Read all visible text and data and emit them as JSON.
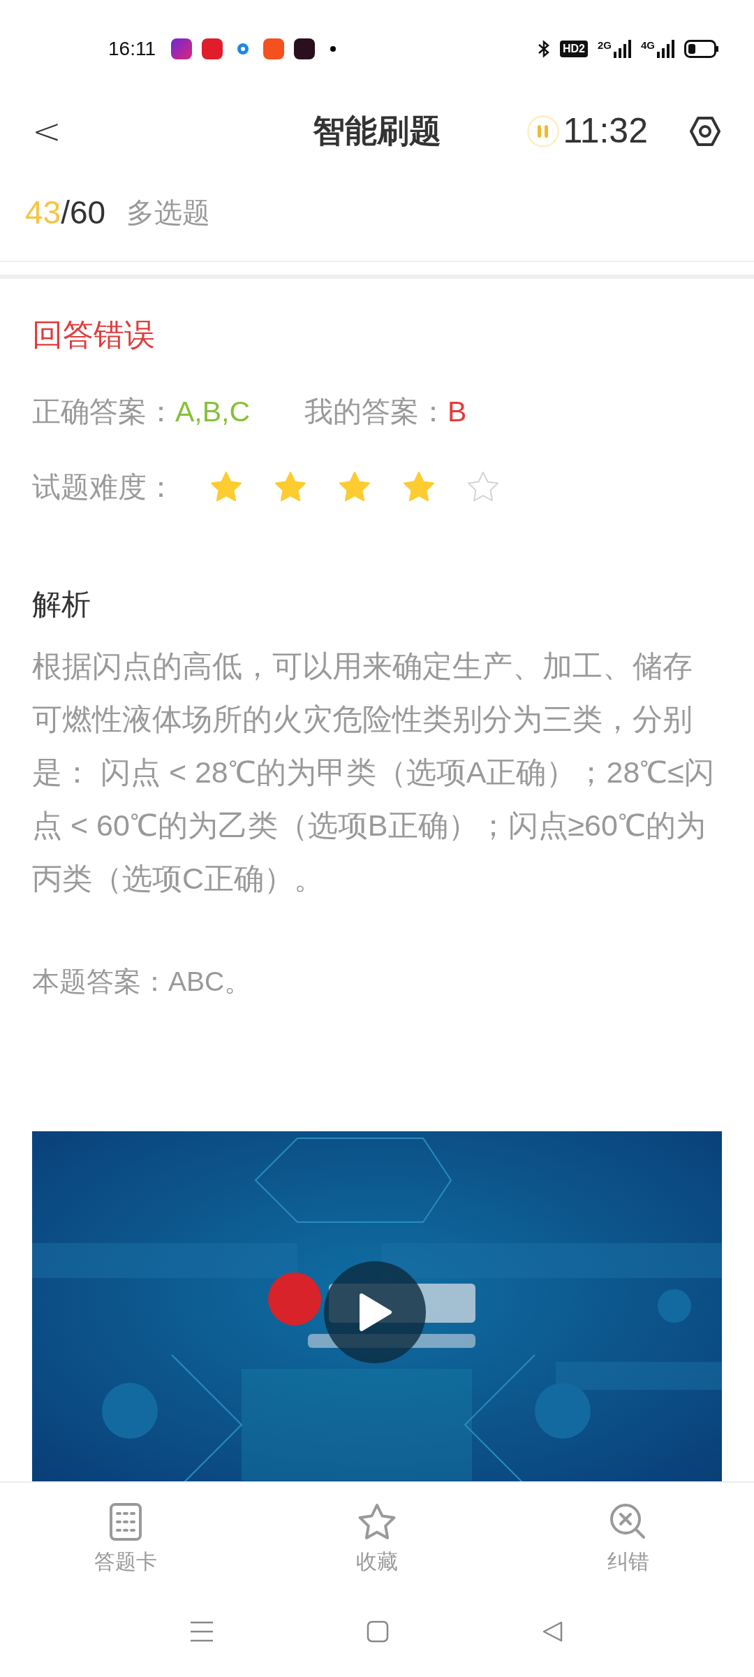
{
  "status_bar": {
    "time": "16:11",
    "network_badge": "HD2",
    "signal_1": "2G",
    "signal_2": "4G"
  },
  "header": {
    "back": "<",
    "title": "智能刷题",
    "timer": "11:32",
    "paused": false
  },
  "progress": {
    "current": "43",
    "total": "/60",
    "type": "多选题"
  },
  "result": {
    "verdict": "回答错误",
    "correct_label": "正确答案：",
    "correct": "A,B,C",
    "mine_label": "我的答案：",
    "mine": "B",
    "difficulty_label": "试题难度：",
    "stars": 4
  },
  "analysis": {
    "heading": "解析",
    "text": "根据闪点的高低，可以用来确定生产、加工、储存可燃性液体场所的火灾危险性类别分为三类，分别是： 闪点 < 28℃的为甲类（选项A正确）；28℃≤闪点 < 60℃的为乙类（选项B正确）；闪点≥60℃的为丙类（选项C正确）。",
    "answer": "本题答案：ABC。"
  },
  "bottom_tabs": [
    {
      "kind": "card",
      "label": "答题卡"
    },
    {
      "kind": "star",
      "label": "收藏"
    },
    {
      "kind": "report",
      "label": "纠错"
    }
  ]
}
